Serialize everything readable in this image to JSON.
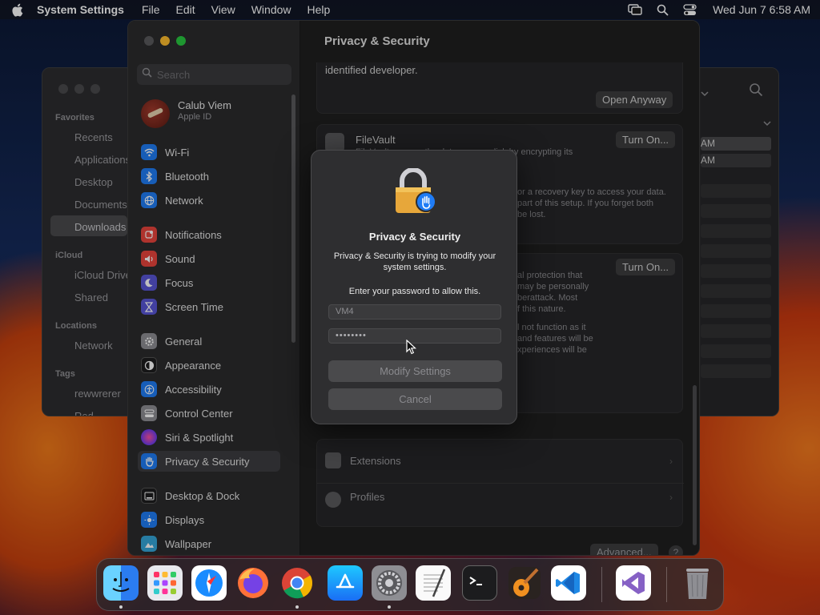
{
  "menubar": {
    "app_name": "System Settings",
    "menus": [
      "File",
      "Edit",
      "View",
      "Window",
      "Help"
    ],
    "clock": "Wed Jun 7  6:58 AM"
  },
  "finder": {
    "sections": {
      "favorites": "Favorites",
      "icloud": "iCloud",
      "locations": "Locations",
      "tags": "Tags"
    },
    "items": [
      "Recents",
      "Applications",
      "Desktop",
      "Documents",
      "Downloads",
      "iCloud Drive",
      "Shared",
      "Network",
      "rewwrerer",
      "Red"
    ],
    "right_rows": [
      "AM",
      "AM"
    ]
  },
  "settings": {
    "search_placeholder": "Search",
    "account": {
      "name": "Calub Viem",
      "sub": "Apple ID"
    },
    "nav": [
      {
        "label": "Wi-Fi",
        "color": "#1f7cf5"
      },
      {
        "label": "Bluetooth",
        "color": "#1f7cf5"
      },
      {
        "label": "Network",
        "color": "#1f7cf5"
      },
      {
        "label": "Notifications",
        "color": "#e8453c"
      },
      {
        "label": "Sound",
        "color": "#e8453c"
      },
      {
        "label": "Focus",
        "color": "#5856d6"
      },
      {
        "label": "Screen Time",
        "color": "#5856d6"
      },
      {
        "label": "General",
        "color": "#8e8e93"
      },
      {
        "label": "Appearance",
        "color": "#1c1c1e"
      },
      {
        "label": "Accessibility",
        "color": "#1f7cf5"
      },
      {
        "label": "Control Center",
        "color": "#8e8e93"
      },
      {
        "label": "Siri & Spotlight",
        "color": "#b44fd6"
      },
      {
        "label": "Privacy & Security",
        "color": "#1f7cf5"
      },
      {
        "label": "Desktop & Dock",
        "color": "#1c1c1e"
      },
      {
        "label": "Displays",
        "color": "#1f7cf5"
      },
      {
        "label": "Wallpaper",
        "color": "#35a6d8"
      }
    ],
    "content": {
      "title": "Privacy & Security",
      "developer_text": "identified developer.",
      "open_anyway": "Open Anyway",
      "filevault_title": "FileVault",
      "filevault_desc": "FileVault secures the data on your disk by encrypting its",
      "filevault_lines": [
        "or a recovery key to access your data.",
        "part of this setup. If you forget both",
        "be lost."
      ],
      "turn_on_1": "Turn On...",
      "turn_on_2": "Turn On...",
      "lockdown_lines": [
        "al protection that",
        "may be personally",
        "berattack. Most",
        "f this nature.",
        "",
        "l not function as it",
        "and features will be",
        "xperiences will be"
      ],
      "extensions": "Extensions",
      "profiles": "Profiles",
      "advanced": "Advanced...",
      "help": "?"
    }
  },
  "dialog": {
    "title": "Privacy & Security",
    "body": "Privacy & Security is trying to modify your system settings.",
    "prompt": "Enter your password to allow this.",
    "username": "VM4",
    "password": "••••••••",
    "modify_label": "Modify Settings",
    "cancel_label": "Cancel"
  },
  "dock": {
    "apps": [
      "finder",
      "launchpad",
      "safari",
      "firefox",
      "chrome",
      "app-store",
      "system-settings",
      "textedit",
      "terminal",
      "garageband",
      "vscode",
      "visual-studio",
      "trash"
    ]
  }
}
